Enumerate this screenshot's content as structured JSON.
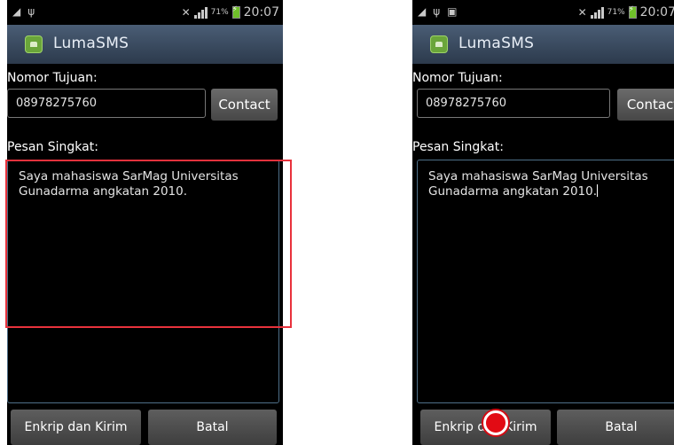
{
  "screens": [
    {
      "status": {
        "battery_pct": "71%",
        "time": "20:07"
      },
      "app_title": "LumaSMS",
      "number_label": "Nomor Tujuan:",
      "number_value": "08978275760",
      "contact_label": "Contact",
      "message_label": "Pesan Singkat:",
      "message_value": "Saya mahasiswa SarMag Universitas Gunadarma angkatan 2010.",
      "encrypt_send_label": "Enkrip dan Kirim",
      "cancel_label": "Batal"
    },
    {
      "status": {
        "battery_pct": "71%",
        "time": "20:07"
      },
      "app_title": "LumaSMS",
      "number_label": "Nomor Tujuan:",
      "number_value": "08978275760",
      "contact_label": "Contact",
      "message_label": "Pesan Singkat:",
      "message_value": "Saya mahasiswa SarMag Universitas Gunadarma angkatan 2010.",
      "encrypt_send_label": "Enkrip dan Kirim",
      "cancel_label": "Batal"
    }
  ],
  "annotations": {
    "highlight_color": "#e8323c",
    "tap_marker_color": "#e20b14"
  },
  "icons": [
    "usb-icon",
    "gallery-icon",
    "mute-icon",
    "signal-icon",
    "battery-icon",
    "app-icon"
  ]
}
